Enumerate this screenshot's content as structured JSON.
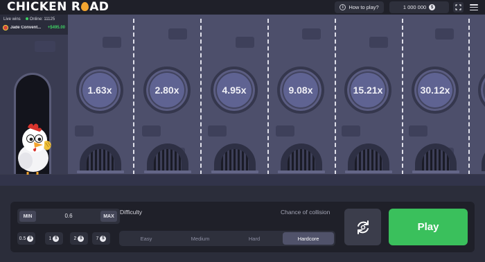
{
  "header": {
    "logo_part1": "CHICKEN R",
    "logo_part2": "AD",
    "how_to_play": "How to play?",
    "balance": "1 000 000",
    "currency_symbol": "$"
  },
  "live": {
    "label": "Live wins",
    "online": "Online: 11125",
    "entry_name": "Jade Convent...",
    "entry_amount": "+$495.00"
  },
  "multipliers": [
    "1.63x",
    "2.80x",
    "4.95x",
    "9.08x",
    "15.21x",
    "30.12x"
  ],
  "controls": {
    "min_label": "MIN",
    "max_label": "MAX",
    "bet_value": "0.6",
    "chips": [
      "0.5",
      "1",
      "2",
      "7"
    ],
    "difficulty_label": "Difficulty",
    "collision_label": "Chance of collision",
    "tabs": [
      "Easy",
      "Medium",
      "Hard",
      "Hardcore"
    ],
    "active_tab": "Hardcore",
    "play_label": "Play"
  },
  "colors": {
    "play": "#3ac05c",
    "online_dot": "#3ecf63",
    "accent_egg": "#f3a530"
  }
}
